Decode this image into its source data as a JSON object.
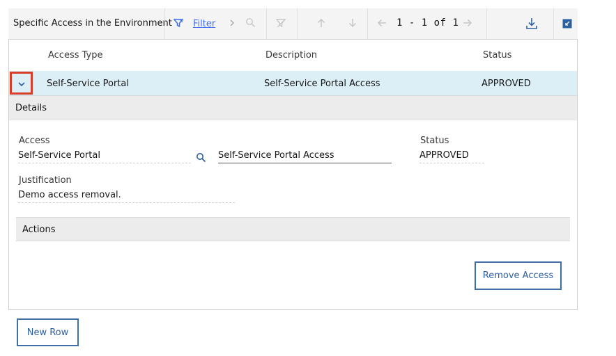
{
  "toolbar": {
    "title": "Specific Access in the Environment",
    "filter_label": "Filter",
    "pagination": "1 - 1 of 1",
    "icons": [
      "filter-icon",
      "chevron-right-icon",
      "search-icon",
      "clear-filter-icon",
      "arrow-up-icon",
      "arrow-down-icon",
      "arrow-left-icon",
      "arrow-right-icon",
      "download-icon",
      "collapse-icon"
    ]
  },
  "table": {
    "columns": [
      "Access Type",
      "Description",
      "Status"
    ],
    "rows": [
      {
        "access_type": "Self-Service Portal",
        "description": "Self-Service Portal Access",
        "status": "APPROVED"
      }
    ]
  },
  "details": {
    "header": "Details",
    "access_label": "Access",
    "access_value": "Self-Service Portal",
    "description_value": "Self-Service Portal Access",
    "status_label": "Status",
    "status_value": "APPROVED",
    "justification_label": "Justification",
    "justification_value": "Demo access removal."
  },
  "actions": {
    "header": "Actions",
    "remove_button": "Remove Access"
  },
  "new_row_button": "New Row",
  "colors": {
    "accent": "#3c6df0",
    "selected_row": "#dceff7",
    "highlight": "#da3c2a"
  }
}
